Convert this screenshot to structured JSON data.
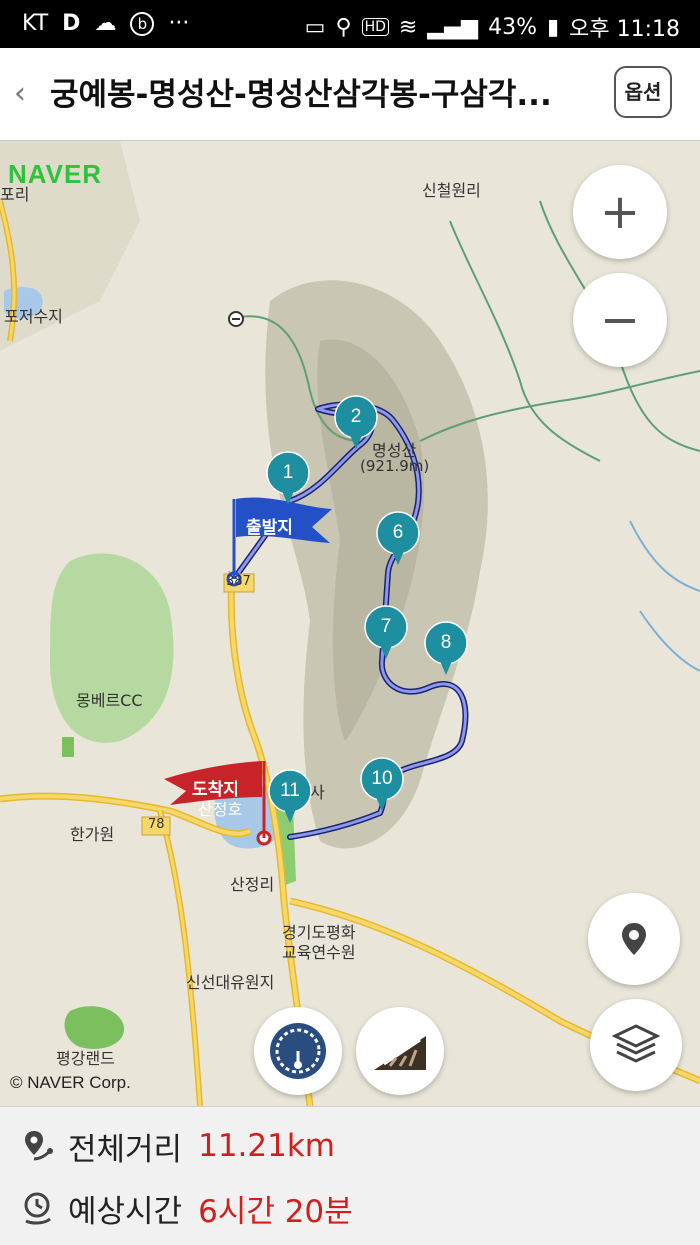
{
  "status_bar": {
    "carrier": "KT",
    "battery": "43%",
    "time": "오후 11:18",
    "hd": "HD"
  },
  "header": {
    "title": "궁예봉-명성산-명성산삼각봉-구삼각...",
    "options_label": "옵션"
  },
  "map": {
    "brand": "NAVER",
    "copyright": "© NAVER Corp.",
    "place_labels": {
      "sincheolwon": "신철원리",
      "pojeo": "포저수지",
      "porri": "포리",
      "myeongseong": "명성산",
      "myeongseong_elev": "(921.9m)",
      "mongbere": "몽베르CC",
      "hangawon": "한가원",
      "sanjeong_ri": "산정리",
      "gyeonggi": "경기도평화",
      "gyeonggi2": "교육연수원",
      "sinseon": "신선대유원지",
      "pyeonggang": "평강랜드",
      "sanjeong_lake": "산정호",
      "temple": "사",
      "road_78": "78",
      "road_387": "387"
    },
    "start_flag": "출발지",
    "end_flag": "도착지",
    "markers": [
      "1",
      "2",
      "6",
      "7",
      "8",
      "10",
      "11"
    ],
    "buttons": {
      "zoom_in": "+",
      "zoom_out": "−"
    },
    "colors": {
      "route": "#2b3aa8",
      "marker": "#1e8fa0",
      "start_flag": "#2350c7",
      "end_flag": "#c9232a",
      "brand": "#2fc23b"
    }
  },
  "summary": {
    "distance_label": "전체거리",
    "distance_value": "11.21km",
    "time_label": "예상시간",
    "time_value": "6시간 20분"
  }
}
